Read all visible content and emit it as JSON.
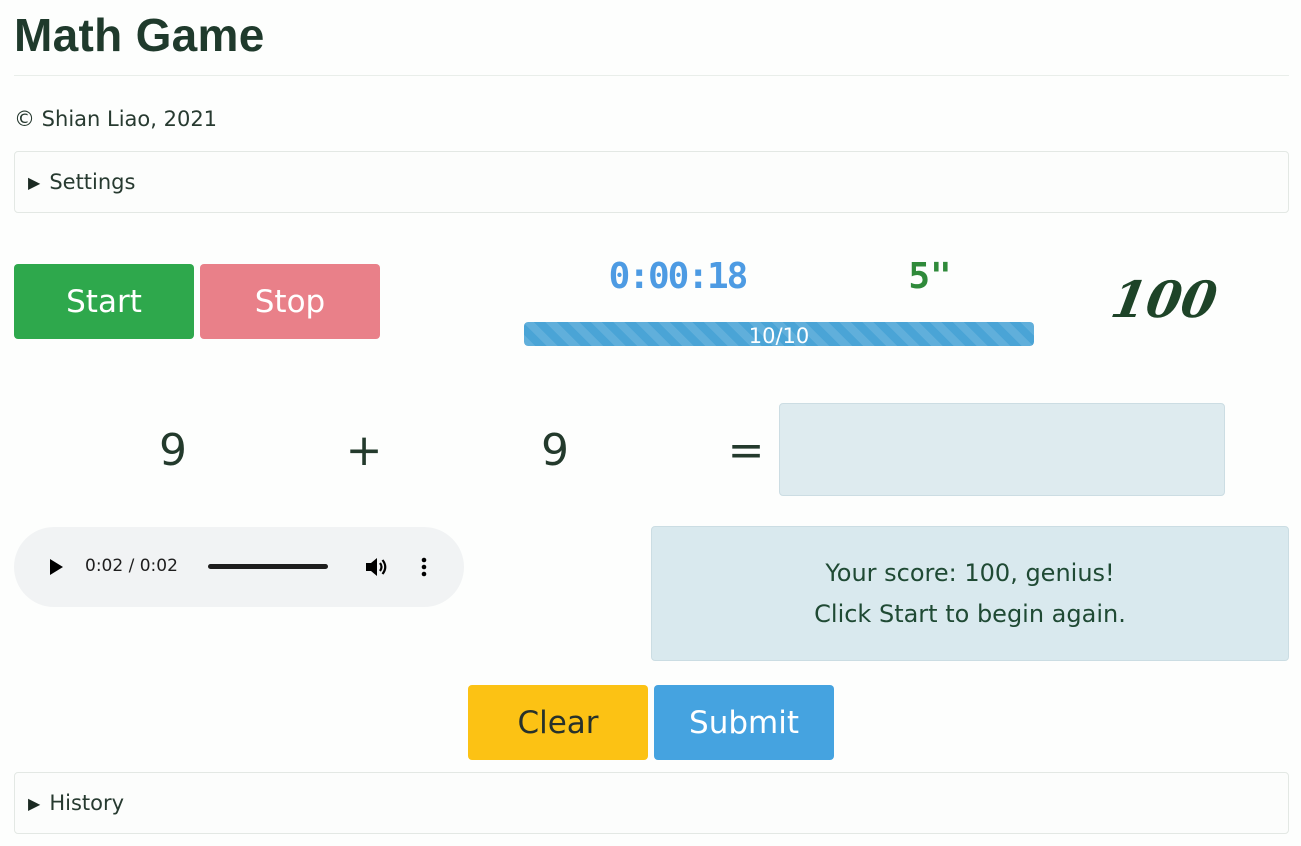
{
  "header": {
    "title": "Math Game",
    "copyright": "© Shian Liao, 2021"
  },
  "settings": {
    "label": "Settings"
  },
  "controls": {
    "start_label": "Start",
    "stop_label": "Stop"
  },
  "status": {
    "timer": "0:00:18",
    "seconds": "5\"",
    "score": "100",
    "progress_text": "10/10",
    "progress_fraction": 1.0
  },
  "question": {
    "operand_a": "9",
    "operator": "+",
    "operand_b": "9",
    "equals": "=",
    "answer_value": ""
  },
  "audio": {
    "time": "0:02 / 0:02",
    "play_icon": "play-icon",
    "volume_icon": "volume-icon",
    "more_icon": "more-options-icon"
  },
  "message": {
    "line1": "Your score: 100, genius!",
    "line2": "Click Start to begin again."
  },
  "actions": {
    "clear_label": "Clear",
    "submit_label": "Submit"
  },
  "history": {
    "label": "History"
  },
  "colors": {
    "start": "#2ea84c",
    "stop": "#e98089",
    "clear": "#fcc214",
    "submit": "#45a3e0",
    "timer": "#4d9be3",
    "seconds": "#2f8a3a",
    "progress": "#4aa4d6",
    "alert_bg": "#d9e9ee"
  }
}
